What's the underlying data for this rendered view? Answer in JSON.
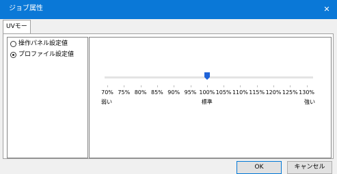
{
  "window": {
    "title": "ジョブ属性",
    "close_glyph": "✕"
  },
  "tabs": [
    {
      "label": "UVモード"
    }
  ],
  "options": [
    {
      "label": "操作パネル設定値",
      "checked": false
    },
    {
      "label": "プロファイル設定値",
      "checked": true
    }
  ],
  "slider": {
    "ticks": [
      "70%",
      "75%",
      "80%",
      "85%",
      "90%",
      "95%",
      "100%",
      "105%",
      "110%",
      "115%",
      "120%",
      "125%",
      "130%"
    ],
    "value": "100%",
    "min_label": "弱い",
    "mid_label": "標準",
    "max_label": "強い",
    "thumb_color": "#1f63d8"
  },
  "buttons": {
    "ok": "OK",
    "cancel": "キャンセル"
  }
}
